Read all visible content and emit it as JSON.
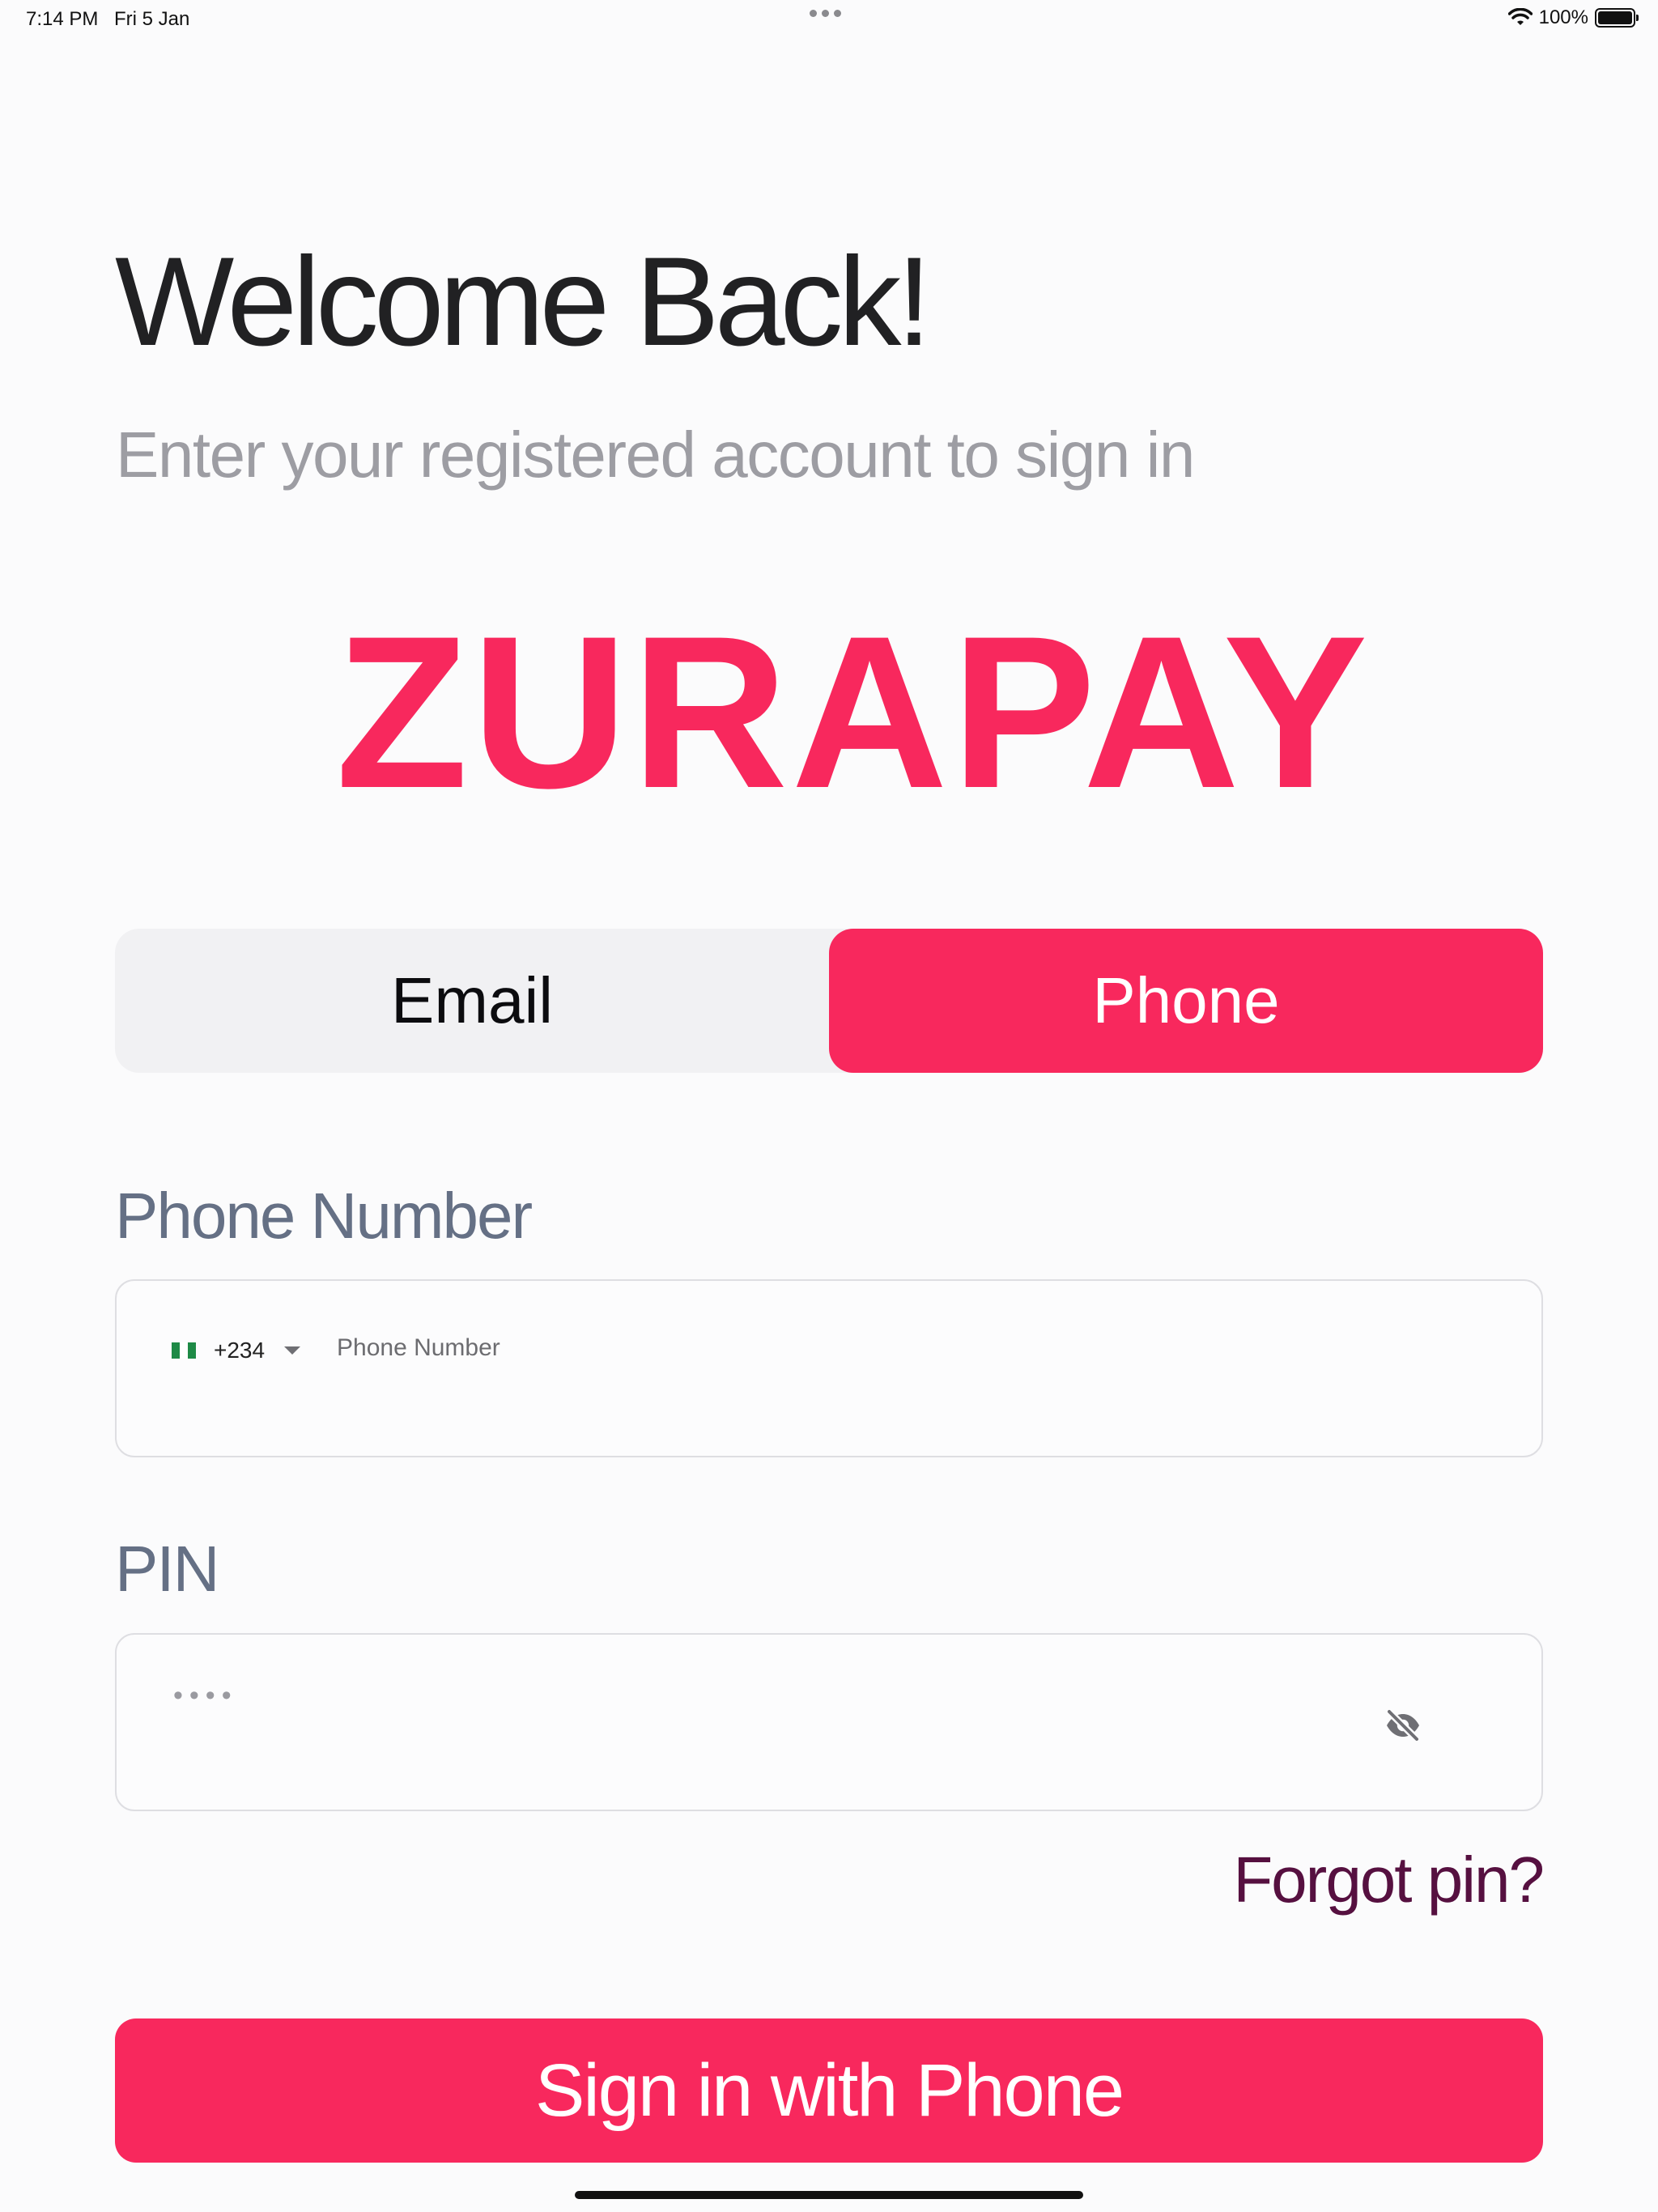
{
  "status_bar": {
    "time": "7:14 PM",
    "date": "Fri 5 Jan",
    "battery": "100%"
  },
  "header": {
    "title": "Welcome Back!",
    "subtitle": "Enter your registered account to sign in"
  },
  "brand": {
    "logo_text": "ZURAPAY",
    "accent_color": "#f8285d"
  },
  "tabs": [
    {
      "label": "Email",
      "selected": false
    },
    {
      "label": "Phone",
      "selected": true
    }
  ],
  "phone_field": {
    "label": "Phone Number",
    "country_code": "+234",
    "flag_icon": "nigeria-flag-icon",
    "placeholder": "Phone Number",
    "value": ""
  },
  "pin_field": {
    "label": "PIN",
    "placeholder": "••••",
    "toggle_icon": "eye-off-icon"
  },
  "links": {
    "forgot_pin": "Forgot pin?"
  },
  "actions": {
    "submit_label": "Sign in with Phone"
  }
}
